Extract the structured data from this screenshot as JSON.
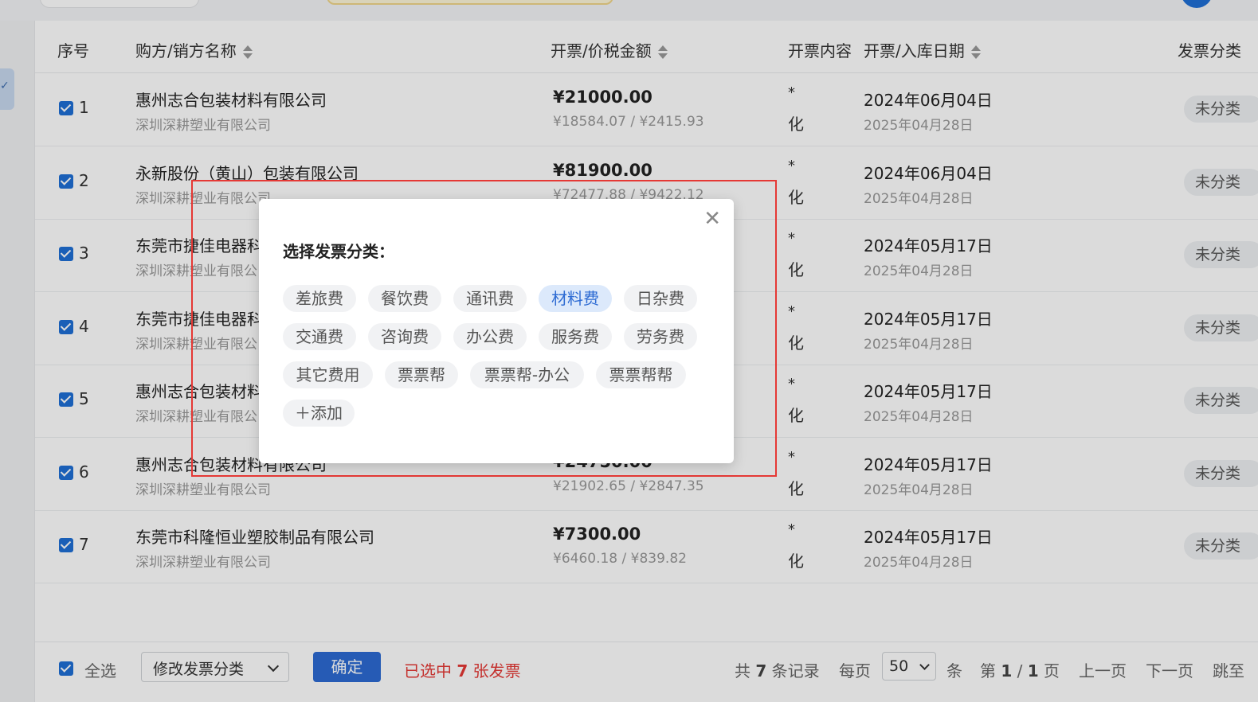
{
  "table": {
    "headers": {
      "index": "序号",
      "party": "购方/销方名称",
      "amount": "开票/价税金额",
      "content": "开票内容",
      "date": "开票/入库日期",
      "category": "发票分类"
    },
    "rows": [
      {
        "index": "1",
        "buyer": "惠州志合包装材料有限公司",
        "seller": "深圳深耕塑业有限公司",
        "amount": "¥21000.00",
        "sub": "¥18584.07 / ¥2415.93",
        "content_star": "*",
        "content_text": "化",
        "date1": "2024年06月04日",
        "date2": "2025年04月28日",
        "category": "未分类"
      },
      {
        "index": "2",
        "buyer": "永新股份（黄山）包装有限公司",
        "seller": "深圳深耕塑业有限公司",
        "amount": "¥81900.00",
        "sub": "¥72477.88 / ¥9422.12",
        "content_star": "*",
        "content_text": "化",
        "date1": "2024年06月04日",
        "date2": "2025年04月28日",
        "category": "未分类"
      },
      {
        "index": "3",
        "buyer": "东莞市捷佳电器科",
        "seller": "深圳深耕塑业有限公",
        "amount": "",
        "sub": "",
        "content_star": "*",
        "content_text": "化",
        "date1": "2024年05月17日",
        "date2": "2025年04月28日",
        "category": "未分类"
      },
      {
        "index": "4",
        "buyer": "东莞市捷佳电器科",
        "seller": "深圳深耕塑业有限公",
        "amount": "",
        "sub": "",
        "content_star": "*",
        "content_text": "化",
        "date1": "2024年05月17日",
        "date2": "2025年04月28日",
        "category": "未分类"
      },
      {
        "index": "5",
        "buyer": "惠州志合包装材料",
        "seller": "深圳深耕塑业有限公",
        "amount": "",
        "sub": "",
        "content_star": "*",
        "content_text": "化",
        "date1": "2024年05月17日",
        "date2": "2025年04月28日",
        "category": "未分类"
      },
      {
        "index": "6",
        "buyer": "惠州志合包装材料有限公司",
        "seller": "深圳深耕塑业有限公司",
        "amount": "¥24750.00",
        "sub": "¥21902.65 / ¥2847.35",
        "content_star": "*",
        "content_text": "化",
        "date1": "2024年05月17日",
        "date2": "2025年04月28日",
        "category": "未分类"
      },
      {
        "index": "7",
        "buyer": "东莞市科隆恒业塑胶制品有限公司",
        "seller": "深圳深耕塑业有限公司",
        "amount": "¥7300.00",
        "sub": "¥6460.18 / ¥839.82",
        "content_star": "*",
        "content_text": "化",
        "date1": "2024年05月17日",
        "date2": "2025年04月28日",
        "category": "未分类"
      }
    ]
  },
  "footer": {
    "select_all": "全选",
    "action_select": "修改发票分类",
    "confirm": "确定",
    "selected_prefix": "已选中 ",
    "selected_count": "7",
    "selected_suffix": " 张发票",
    "total_prefix": "共 ",
    "total_count": "7",
    "total_suffix": " 条记录",
    "per_page_label": "每页",
    "per_page_value": "50",
    "per_page_unit": "条",
    "page_prefix": "第 ",
    "page_current": "1",
    "page_sep": " / ",
    "page_total": "1",
    "page_suffix": " 页",
    "prev": "上一页",
    "next": "下一页",
    "jump": "跳至"
  },
  "modal": {
    "title": "选择发票分类：",
    "close_icon": "close-icon",
    "tags": [
      {
        "label": "差旅费",
        "active": false
      },
      {
        "label": "餐饮费",
        "active": false
      },
      {
        "label": "通讯费",
        "active": false
      },
      {
        "label": "材料费",
        "active": true
      },
      {
        "label": "日杂费",
        "active": false
      },
      {
        "label": "交通费",
        "active": false
      },
      {
        "label": "咨询费",
        "active": false
      },
      {
        "label": "办公费",
        "active": false
      },
      {
        "label": "服务费",
        "active": false
      },
      {
        "label": "劳务费",
        "active": false
      },
      {
        "label": "其它费用",
        "active": false
      },
      {
        "label": "票票帮",
        "active": false
      },
      {
        "label": "票票帮-办公",
        "active": false
      },
      {
        "label": "票票帮帮",
        "active": false
      }
    ],
    "add_label": "＋添加"
  },
  "colors": {
    "primary": "#2d6bd3",
    "danger": "#e53935",
    "active_tag_bg": "#dce9fb"
  }
}
